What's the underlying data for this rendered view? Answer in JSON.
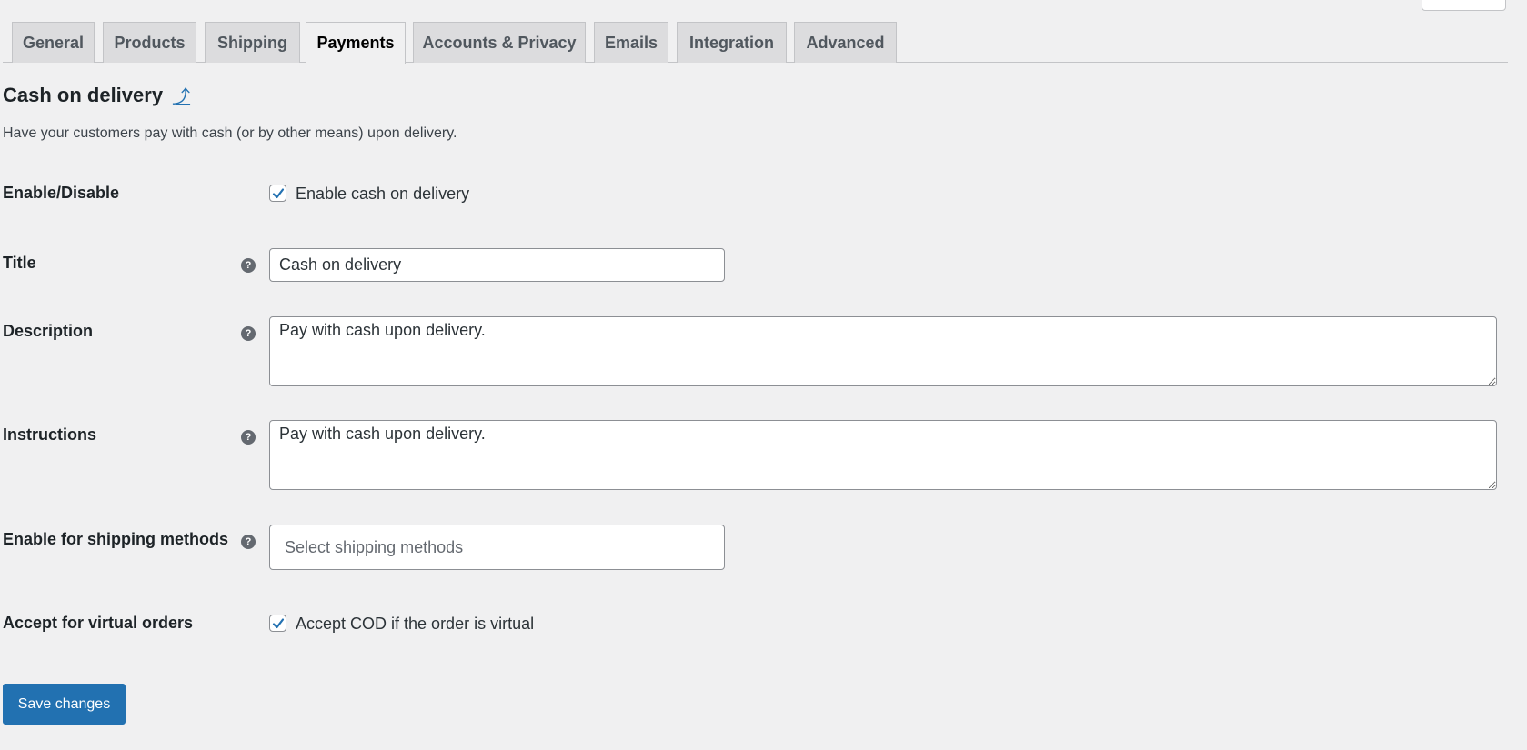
{
  "tabs": [
    {
      "label": "General",
      "active": false
    },
    {
      "label": "Products",
      "active": false
    },
    {
      "label": "Shipping",
      "active": false
    },
    {
      "label": "Payments",
      "active": true
    },
    {
      "label": "Accounts & Privacy",
      "active": false
    },
    {
      "label": "Emails",
      "active": false
    },
    {
      "label": "Integration",
      "active": false
    },
    {
      "label": "Advanced",
      "active": false
    }
  ],
  "section": {
    "title": "Cash on delivery",
    "uplink_glyph": "⤴",
    "description": "Have your customers pay with cash (or by other means) upon delivery."
  },
  "fields": {
    "enable": {
      "label": "Enable/Disable",
      "checkbox_label": "Enable cash on delivery",
      "checked": true
    },
    "title": {
      "label": "Title",
      "value": "Cash on delivery"
    },
    "description": {
      "label": "Description",
      "value": "Pay with cash upon delivery."
    },
    "instructions": {
      "label": "Instructions",
      "value": "Pay with cash upon delivery."
    },
    "shipping_methods": {
      "label": "Enable for shipping methods",
      "placeholder": "Select shipping methods"
    },
    "virtual": {
      "label": "Accept for virtual orders",
      "checkbox_label": "Accept COD if the order is virtual",
      "checked": true
    }
  },
  "help_glyph": "?",
  "save_label": "Save changes",
  "colors": {
    "accent": "#2271b1",
    "tab_bg": "#dcdcde",
    "page_bg": "#f0f0f1"
  }
}
